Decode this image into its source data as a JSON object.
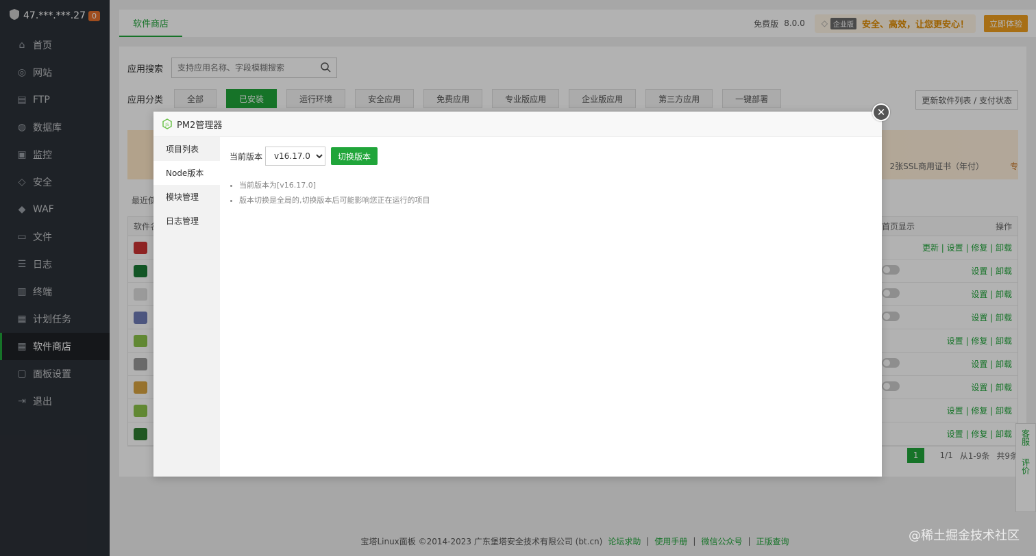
{
  "sidebar": {
    "ip": "47.***.***.27",
    "badge": "0",
    "items": [
      {
        "label": "首页"
      },
      {
        "label": "网站"
      },
      {
        "label": "FTP"
      },
      {
        "label": "数据库"
      },
      {
        "label": "监控"
      },
      {
        "label": "安全"
      },
      {
        "label": "WAF"
      },
      {
        "label": "文件"
      },
      {
        "label": "日志"
      },
      {
        "label": "终端"
      },
      {
        "label": "计划任务"
      },
      {
        "label": "软件商店"
      },
      {
        "label": "面板设置"
      },
      {
        "label": "退出"
      }
    ]
  },
  "topbar": {
    "tab": "软件商店",
    "edition": "免费版",
    "version": "8.0.0",
    "ent_tag": "企业版",
    "promo": "安全、高效，让您更安心！",
    "try_label": "立即体验"
  },
  "store": {
    "search_label": "应用搜索",
    "search_placeholder": "支持应用名称、字段模糊搜索",
    "category_label": "应用分类",
    "categories": [
      "全部",
      "已安装",
      "运行环境",
      "安全应用",
      "免费应用",
      "专业版应用",
      "企业版应用",
      "第三方应用",
      "一键部署"
    ],
    "refresh_label": "更新软件列表 / 支付状态",
    "banner_text": "2张SSL商用证书（年付）",
    "banner_text2": "专",
    "recent_label": "最近使",
    "col_name": "软件名",
    "col_home": "首页显示",
    "col_ops": "操作",
    "rows": [
      {
        "ops": "更新 | 设置 | 修复 | 卸载",
        "on": true
      },
      {
        "ops": "设置 | 卸载",
        "on": false
      },
      {
        "ops": "设置 | 卸载",
        "on": false
      },
      {
        "ops": "设置 | 卸载",
        "on": false
      },
      {
        "ops": "设置 | 修复 | 卸载",
        "on": false
      },
      {
        "ops": "设置 | 卸载",
        "on": false
      },
      {
        "ops": "设置 | 卸载",
        "on": false
      },
      {
        "ops": "设置 | 修复 | 卸载",
        "on": true
      },
      {
        "ops": "设置 | 修复 | 卸载",
        "on": true
      }
    ],
    "pager": {
      "page": "1",
      "pages": "1/1",
      "range": "从1-9条",
      "total": "共9条"
    }
  },
  "footer": {
    "copyright": "宝塔Linux面板 ©2014-2023 广东堡塔安全技术有限公司 (bt.cn)",
    "links": [
      "论坛求助",
      "使用手册",
      "微信公众号",
      "正版查询"
    ],
    "watermark": "@稀土掘金技术社区"
  },
  "side_tools": {
    "service": "客服",
    "review": "评价"
  },
  "modal": {
    "title": "PM2管理器",
    "nav": [
      "项目列表",
      "Node版本",
      "模块管理",
      "日志管理"
    ],
    "current_label": "当前版本",
    "version_value": "v16.17.0",
    "switch_label": "切换版本",
    "notes": [
      "当前版本为[v16.17.0]",
      "版本切换是全局的,切换版本后可能影响您正在运行的项目"
    ]
  },
  "colors": {
    "accent": "#20a53a",
    "sidebar_bg": "#2c3138"
  }
}
